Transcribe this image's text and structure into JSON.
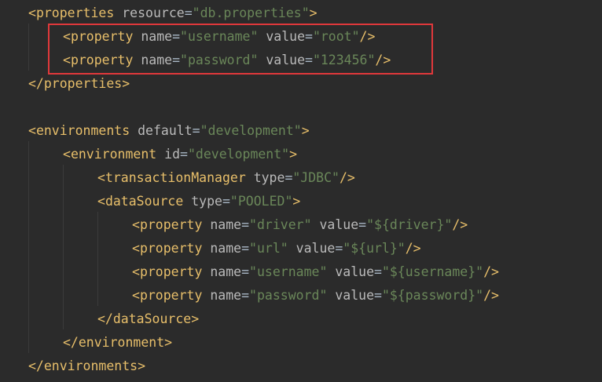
{
  "colors": {
    "background": "#2b2b2b",
    "tag": "#e8bf6a",
    "attribute": "#bababa",
    "value": "#6a8759",
    "highlight_border": "#e0383b"
  },
  "code": {
    "l1": {
      "open": "<",
      "tag": "properties",
      "a1": "resource",
      "v1": "\"db.properties\"",
      "close": ">"
    },
    "l2": {
      "open": "<",
      "tag": "property",
      "a1": "name",
      "v1": "\"username\"",
      "a2": "value",
      "v2": "\"root\"",
      "close": "/>"
    },
    "l3": {
      "open": "<",
      "tag": "property",
      "a1": "name",
      "v1": "\"password\"",
      "a2": "value",
      "v2": "\"123456\"",
      "close": "/>"
    },
    "l4": {
      "text": "</properties>"
    },
    "l6": {
      "open": "<",
      "tag": "environments",
      "a1": "default",
      "v1": "\"development\"",
      "close": ">"
    },
    "l7": {
      "open": "<",
      "tag": "environment",
      "a1": "id",
      "v1": "\"development\"",
      "close": ">"
    },
    "l8": {
      "open": "<",
      "tag": "transactionManager",
      "a1": "type",
      "v1": "\"JDBC\"",
      "close": "/>"
    },
    "l9": {
      "open": "<",
      "tag": "dataSource",
      "a1": "type",
      "v1": "\"POOLED\"",
      "close": ">"
    },
    "l10": {
      "open": "<",
      "tag": "property",
      "a1": "name",
      "v1": "\"driver\"",
      "a2": "value",
      "v2": "\"${driver}\"",
      "close": "/>"
    },
    "l11": {
      "open": "<",
      "tag": "property",
      "a1": "name",
      "v1": "\"url\"",
      "a2": "value",
      "v2": "\"${url}\"",
      "close": "/>"
    },
    "l12": {
      "open": "<",
      "tag": "property",
      "a1": "name",
      "v1": "\"username\"",
      "a2": "value",
      "v2": "\"${username}\"",
      "close": "/>"
    },
    "l13": {
      "open": "<",
      "tag": "property",
      "a1": "name",
      "v1": "\"password\"",
      "a2": "value",
      "v2": "\"${password}\"",
      "close": "/>"
    },
    "l14": {
      "text": "</dataSource>"
    },
    "l15": {
      "text": "</environment>"
    },
    "l16": {
      "text": "</environments>"
    },
    "eq": "="
  }
}
